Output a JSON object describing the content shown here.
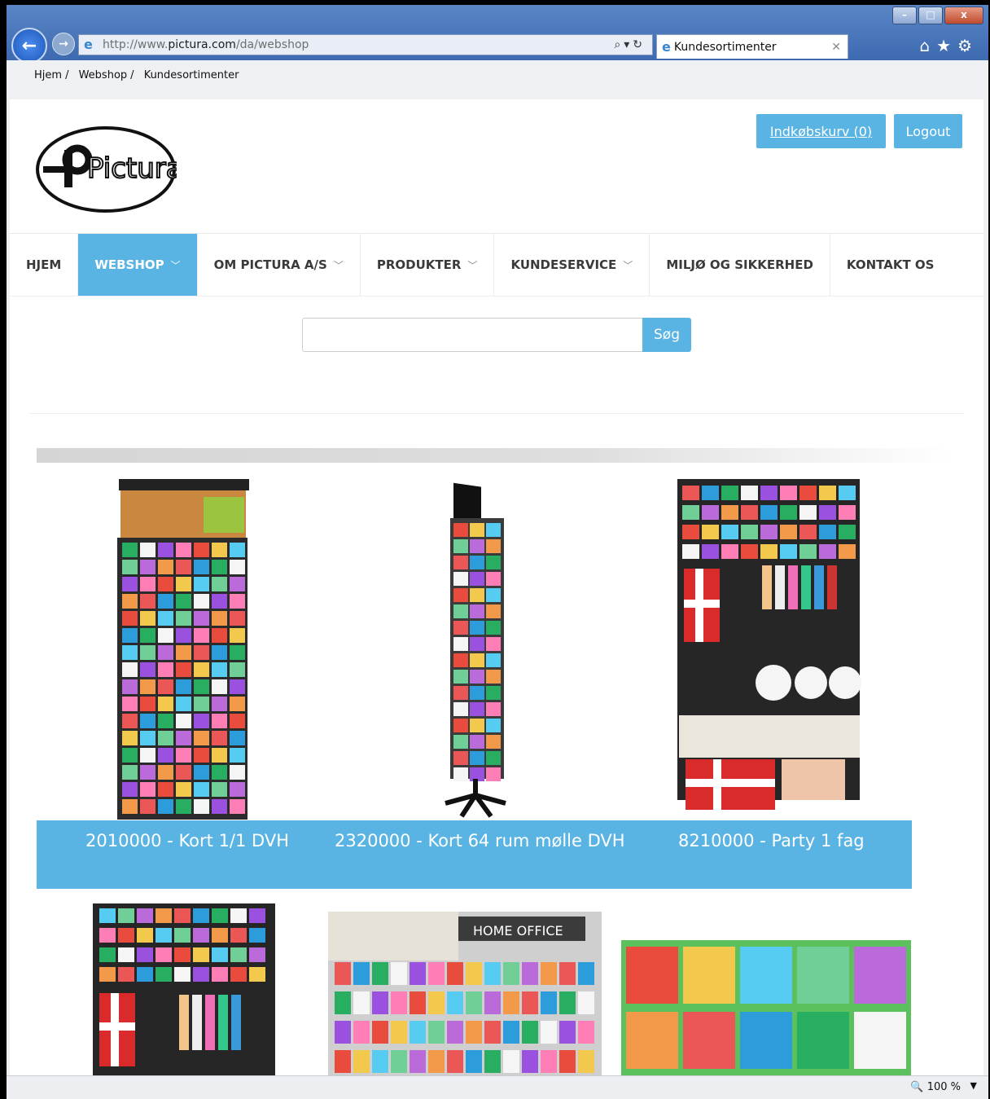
{
  "browser": {
    "url_prefix": "http://www.",
    "url_domain": "pictura.com",
    "url_path": "/da/webshop",
    "tab_title": "Kundesortimenter",
    "window_min": "–",
    "window_max": "□",
    "window_close": "x",
    "status_zoom": "100 %"
  },
  "breadcrumb": {
    "items": [
      "Hjem",
      "Webshop",
      "Kundesortimenter"
    ],
    "sep": "/"
  },
  "header": {
    "logo_text": "Pictura",
    "cart_label": "Indkøbskurv (0)",
    "logout_label": "Logout"
  },
  "nav": {
    "items": [
      {
        "label": "HJEM",
        "chevron": false
      },
      {
        "label": "WEBSHOP",
        "chevron": true,
        "active": true
      },
      {
        "label": "OM PICTURA A/S",
        "chevron": true
      },
      {
        "label": "PRODUKTER",
        "chevron": true
      },
      {
        "label": "KUNDESERVICE",
        "chevron": true
      },
      {
        "label": "MILJØ OG SIKKERHED",
        "chevron": false
      },
      {
        "label": "KONTAKT OS",
        "chevron": false
      }
    ]
  },
  "search": {
    "value": "",
    "button_label": "Søg"
  },
  "products": [
    {
      "caption": "2010000 - Kort 1/1 DVH"
    },
    {
      "caption": "2320000 - Kort 64 rum mølle DVH"
    },
    {
      "caption": "8210000 - Party 1 fag"
    }
  ],
  "product_row2": {
    "home_office_label": "HOME OFFICE"
  },
  "colors": {
    "accent": "#5ab4e3"
  }
}
